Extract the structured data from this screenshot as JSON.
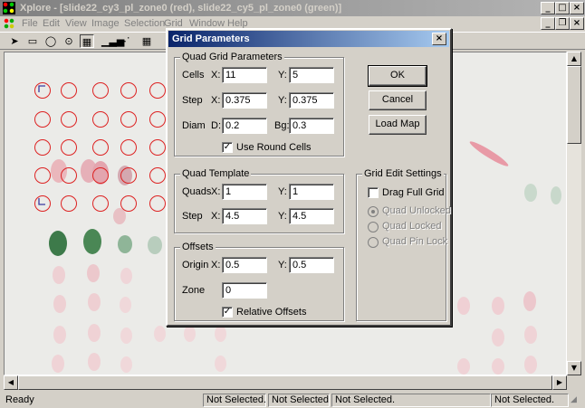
{
  "window": {
    "title": "Xplore - [slide22_cy3_pl_zone0 (red), slide22_cy5_pl_zone0 (green)]",
    "controls": [
      "minimize-icon",
      "maximize-icon",
      "close-icon"
    ]
  },
  "menu": {
    "items": [
      "File",
      "Edit",
      "View",
      "Image",
      "Selection",
      "Grid",
      "Window",
      "Help"
    ]
  },
  "toolbar": {
    "tools": [
      "pointer-icon",
      "rectangle-select-icon",
      "ellipse-select-icon",
      "target-icon",
      "grid-pattern-icon",
      "histogram-icon",
      "scatter-plot-icon",
      "grid-icon"
    ]
  },
  "statusbar": {
    "ready": "Ready",
    "pane1": "Not Selected.",
    "pane2": "Not Selected.",
    "pane3": "Not Selected.",
    "pane4": "Not Selected."
  },
  "dialog": {
    "title": "Grid Parameters",
    "quad_grid": {
      "label": "Quad Grid Parameters",
      "cells_label": "Cells",
      "cells_x": "11",
      "cells_y": "5",
      "step_label": "Step",
      "step_x": "0.375",
      "step_y": "0.375",
      "diam_label": "Diam",
      "diam_d_label": "D:",
      "diam_d": "0.2",
      "bg_label": "Bg:",
      "bg": "0.3",
      "round_cells_label": "Use Round Cells",
      "round_cells_checked": true
    },
    "quad_template": {
      "label": "Quad Template",
      "quads_label": "Quads",
      "quads_x": "1",
      "quads_y": "1",
      "step_label": "Step",
      "step_x": "4.5",
      "step_y": "4.5"
    },
    "offsets": {
      "label": "Offsets",
      "origin_label": "Origin",
      "origin_x": "0.5",
      "origin_y": "0.5",
      "zone_label": "Zone",
      "zone": "0",
      "relative_label": "Relative Offsets",
      "relative_checked": true
    },
    "grid_edit": {
      "label": "Grid Edit Settings",
      "drag_full_grid_label": "Drag Full Grid",
      "drag_full_grid_checked": false,
      "radio_unlocked": "Quad Unlocked",
      "radio_locked": "Quad Locked",
      "radio_pin_lock": "Quad Pin Lock",
      "selected": "Quad Unlocked"
    },
    "x_label": "X:",
    "y_label": "Y:",
    "buttons": {
      "ok": "OK",
      "cancel": "Cancel",
      "load_map": "Load Map"
    }
  },
  "colors": {
    "grid_ring": "#dd2222",
    "spot_red": "#e8a8b0",
    "spot_green": "#3a7a48",
    "dialog_title": "#0a246a",
    "inactive_title": "#808080"
  }
}
